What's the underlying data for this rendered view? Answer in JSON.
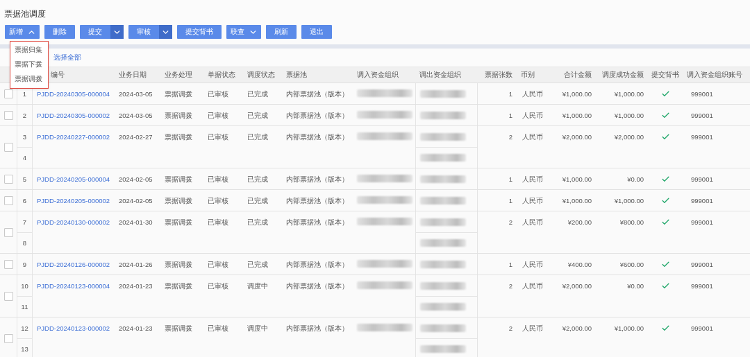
{
  "page_title": "票据池调度",
  "toolbar": [
    {
      "label": "新增",
      "kind": "dropdown",
      "expanded": true
    },
    {
      "label": "删除",
      "kind": "plain"
    },
    {
      "label": "提交",
      "kind": "split",
      "expanded": false
    },
    {
      "label": "审核",
      "kind": "split",
      "expanded": false
    },
    {
      "label": "提交背书",
      "kind": "plain"
    },
    {
      "label": "联查",
      "kind": "dropdown",
      "expanded": false
    },
    {
      "label": "刷新",
      "kind": "plain"
    },
    {
      "label": "退出",
      "kind": "plain"
    }
  ],
  "menu": {
    "items": [
      "票据归集",
      "票据下拨",
      "票据调拨"
    ]
  },
  "select_all": "选择全部",
  "columns": [
    "编号",
    "业务日期",
    "业务处理",
    "单据状态",
    "调度状态",
    "票据池",
    "调入资金组织",
    "调出资金组织",
    "票据张数",
    "币别",
    "合计金额",
    "调度成功金额",
    "提交背书",
    "调入资金组织账号"
  ],
  "rows": [
    {
      "numbers": [
        "1"
      ],
      "checked": false,
      "code": "PJDD-20240305-000004",
      "date": "2024-03-05",
      "process": "票据调拨",
      "doc_status": "已审核",
      "dispatch_status": "已完成",
      "pool": "内部票据池（版本）",
      "count": "1",
      "currency": "人民币",
      "total": "¥1,000.00",
      "success": "¥1,000.00",
      "endorsed": true,
      "account": "999001"
    },
    {
      "numbers": [
        "2"
      ],
      "checked": false,
      "code": "PJDD-20240305-000002",
      "date": "2024-03-05",
      "process": "票据调拨",
      "doc_status": "已审核",
      "dispatch_status": "已完成",
      "pool": "内部票据池（版本）",
      "count": "1",
      "currency": "人民币",
      "total": "¥1,000.00",
      "success": "¥1,000.00",
      "endorsed": true,
      "account": "999001"
    },
    {
      "numbers": [
        "3",
        "4"
      ],
      "checked": false,
      "code": "PJDD-20240227-000002",
      "date": "2024-02-27",
      "process": "票据调拨",
      "doc_status": "已审核",
      "dispatch_status": "已完成",
      "pool": "内部票据池（版本）",
      "count": "2",
      "currency": "人民币",
      "total": "¥2,000.00",
      "success": "¥2,000.00",
      "endorsed": true,
      "account": "999001"
    },
    {
      "numbers": [
        "5"
      ],
      "checked": false,
      "code": "PJDD-20240205-000004",
      "date": "2024-02-05",
      "process": "票据调拨",
      "doc_status": "已审核",
      "dispatch_status": "已完成",
      "pool": "内部票据池（版本）",
      "count": "1",
      "currency": "人民币",
      "total": "¥1,000.00",
      "success": "¥0.00",
      "endorsed": true,
      "account": "999001"
    },
    {
      "numbers": [
        "6"
      ],
      "checked": false,
      "code": "PJDD-20240205-000002",
      "date": "2024-02-05",
      "process": "票据调拨",
      "doc_status": "已审核",
      "dispatch_status": "已完成",
      "pool": "内部票据池（版本）",
      "count": "1",
      "currency": "人民币",
      "total": "¥1,000.00",
      "success": "¥1,000.00",
      "endorsed": true,
      "account": "999001"
    },
    {
      "numbers": [
        "7",
        "8"
      ],
      "checked": false,
      "code": "PJDD-20240130-000002",
      "date": "2024-01-30",
      "process": "票据调拨",
      "doc_status": "已审核",
      "dispatch_status": "已完成",
      "pool": "内部票据池（版本）",
      "count": "2",
      "currency": "人民币",
      "total": "¥200.00",
      "success": "¥800.00",
      "endorsed": true,
      "account": "999001"
    },
    {
      "numbers": [
        "9"
      ],
      "checked": false,
      "code": "PJDD-20240126-000002",
      "date": "2024-01-26",
      "process": "票据调拨",
      "doc_status": "已审核",
      "dispatch_status": "已完成",
      "pool": "内部票据池（版本）",
      "count": "1",
      "currency": "人民币",
      "total": "¥400.00",
      "success": "¥600.00",
      "endorsed": true,
      "account": "999001"
    },
    {
      "numbers": [
        "10",
        "11"
      ],
      "checked": false,
      "code": "PJDD-20240123-000004",
      "date": "2024-01-23",
      "process": "票据调拨",
      "doc_status": "已审核",
      "dispatch_status": "调度中",
      "pool": "内部票据池（版本）",
      "count": "2",
      "currency": "人民币",
      "total": "¥2,000.00",
      "success": "¥0.00",
      "endorsed": true,
      "account": "999001"
    },
    {
      "numbers": [
        "12",
        "13"
      ],
      "checked": false,
      "code": "PJDD-20240123-000002",
      "date": "2024-01-23",
      "process": "票据调拨",
      "doc_status": "已审核",
      "dispatch_status": "调度中",
      "pool": "内部票据池（版本）",
      "count": "2",
      "currency": "人民币",
      "total": "¥2,000.00",
      "success": "¥1,000.00",
      "endorsed": true,
      "account": "999001"
    }
  ]
}
